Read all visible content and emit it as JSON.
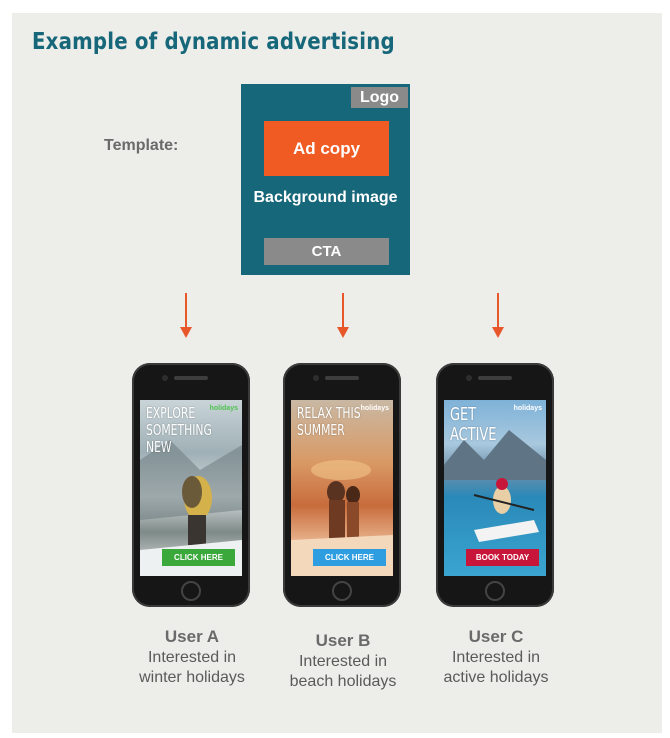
{
  "title": "Example of dynamic advertising",
  "template": {
    "label": "Template:",
    "logo": "Logo",
    "ad_copy": "Ad copy",
    "background": "Background image",
    "cta": "CTA"
  },
  "colors": {
    "panel": "#ededea",
    "teal": "#17677a",
    "orange": "#f05a23",
    "gray_box": "#8a8a8a",
    "green_cta": "#3aa83a",
    "blue_cta": "#2f9ee0",
    "red_cta": "#c8163a"
  },
  "phones": [
    {
      "headline": "EXPLORE\nSOMETHING\nNEW",
      "brand": "holidays",
      "cta": "CLICK HERE",
      "user": "User A",
      "interest": "Interested in winter holidays"
    },
    {
      "headline": "RELAX THIS\nSUMMER",
      "brand": "holidays",
      "cta": "CLICK HERE",
      "user": "User B",
      "interest": "Interested in beach holidays"
    },
    {
      "headline": "GET\nACTIVE",
      "brand": "holidays",
      "cta": "BOOK TODAY",
      "user": "User C",
      "interest": "Interested in active holidays"
    }
  ]
}
